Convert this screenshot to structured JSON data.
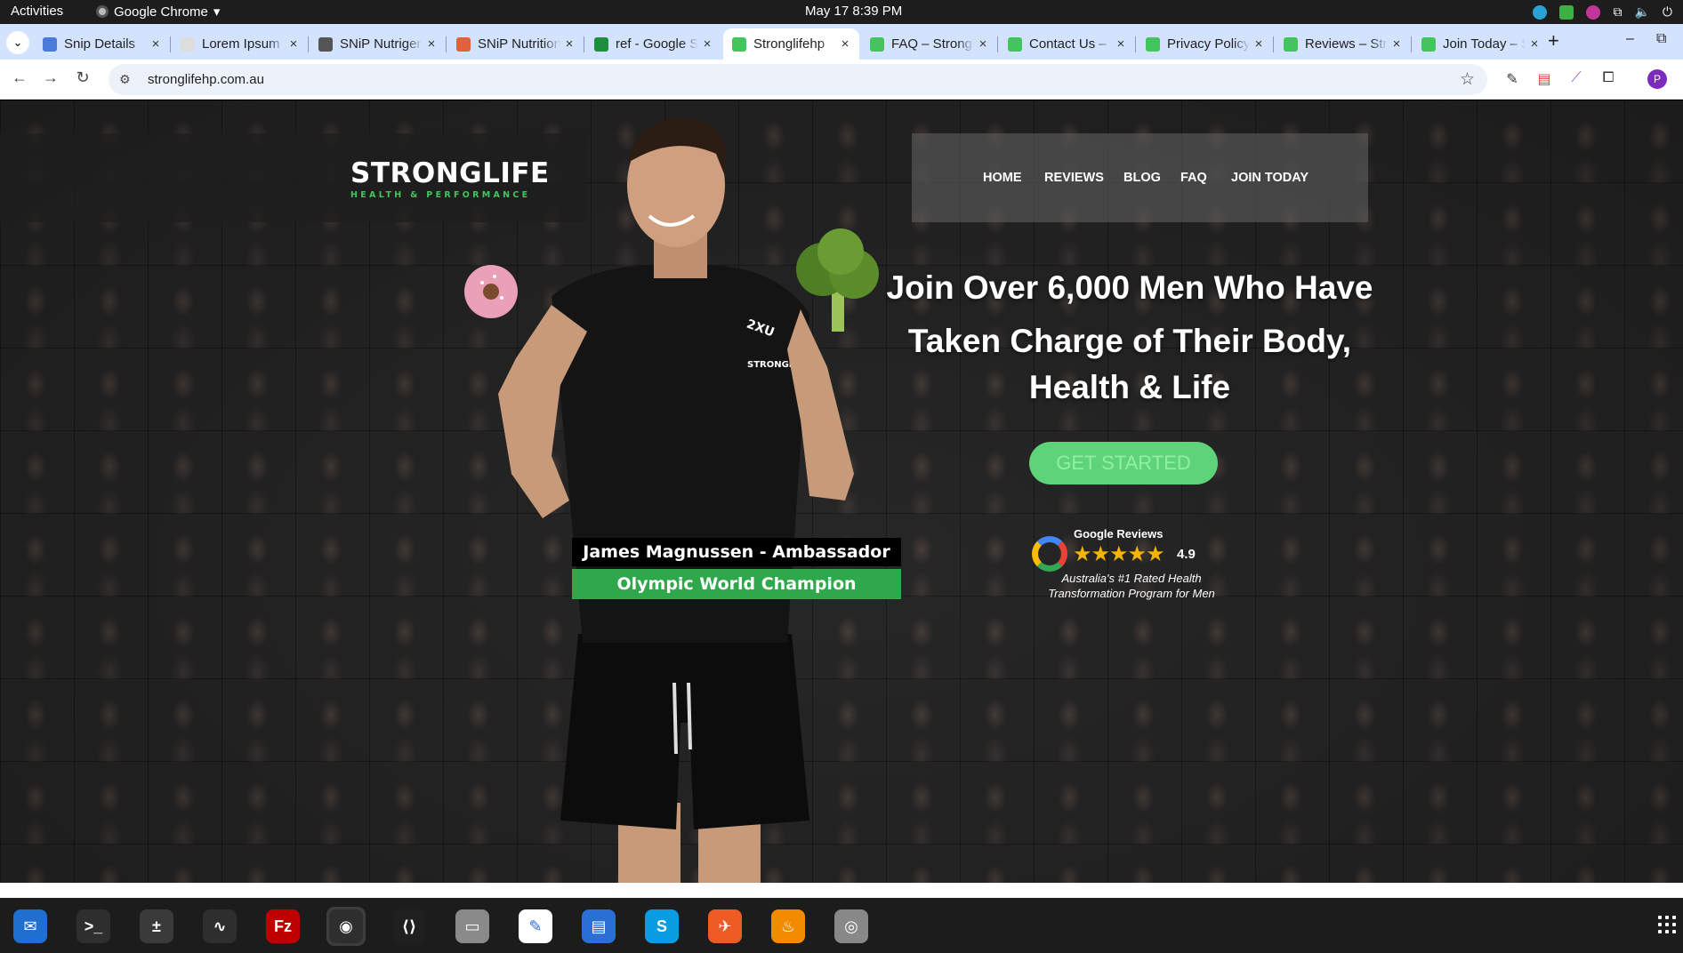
{
  "topbar": {
    "activities": "Activities",
    "app_name": "Google Chrome",
    "clock": "May 17  8:39 PM"
  },
  "tabs": [
    {
      "title": "Snip Details",
      "favicon_color": "#4a7bd8"
    },
    {
      "title": "Lorem Ipsum",
      "favicon_color": "#dddddd"
    },
    {
      "title": "SNiP Nutrigenomics",
      "favicon_color": "#555555"
    },
    {
      "title": "SNiP Nutrition",
      "favicon_color": "#e0623a"
    },
    {
      "title": "ref - Google Sheets",
      "favicon_color": "#1e8e3e"
    },
    {
      "title": "Stronglifehp",
      "favicon_color": "#43c55e",
      "active": true
    },
    {
      "title": "FAQ – Stronglife",
      "favicon_color": "#43c55e"
    },
    {
      "title": "Contact Us – Stronglife",
      "favicon_color": "#43c55e"
    },
    {
      "title": "Privacy Policy",
      "favicon_color": "#43c55e"
    },
    {
      "title": "Reviews – Stronglife",
      "favicon_color": "#43c55e"
    },
    {
      "title": "Join Today – Stronglife",
      "favicon_color": "#43c55e"
    }
  ],
  "address_bar": {
    "url": "stronglifehp.com.au"
  },
  "profile_initial": "P",
  "site": {
    "logo_main": "STRONGLIFE",
    "logo_sub": "HEALTH & PERFORMANCE",
    "nav": [
      "HOME",
      "REVIEWS",
      "BLOG",
      "FAQ",
      "JOIN TODAY"
    ],
    "hero_title_line1": "Join Over 6,000 Men Who Have",
    "hero_title_line2": "Taken Charge of Their Body,",
    "hero_title_line3": "Health & Life",
    "cta": "GET STARTED",
    "reviews_title": "Google Reviews",
    "reviews_stars": "★★★★★",
    "reviews_score": "4.9",
    "reviews_tagline_1": "Australia's #1 Rated Health",
    "reviews_tagline_2": "Transformation Program for Men",
    "ambassador": "James Magnussen - Ambassador",
    "champion": "Olympic World Champion",
    "shirt_logo": "STRONGLIFE",
    "shirt_brand": "2XU"
  },
  "dock": [
    {
      "name": "thunderbird",
      "color": "#1f6fd0"
    },
    {
      "name": "terminal",
      "color": "#2e2e2e"
    },
    {
      "name": "calculator",
      "color": "#3a3a3a"
    },
    {
      "name": "system-monitor",
      "color": "#2e2e2e"
    },
    {
      "name": "filezilla",
      "color": "#bf0000"
    },
    {
      "name": "chrome",
      "color": "#2e2e2e",
      "running": true
    },
    {
      "name": "vscode",
      "color": "#1f1f1f"
    },
    {
      "name": "files",
      "color": "#8a8a8a"
    },
    {
      "name": "text-editor",
      "color": "#ffffff"
    },
    {
      "name": "libreoffice-writer",
      "color": "#2a6fd6"
    },
    {
      "name": "skype",
      "color": "#0a9ce0"
    },
    {
      "name": "postman",
      "color": "#ef5b25"
    },
    {
      "name": "app-flame",
      "color": "#f28b00"
    },
    {
      "name": "disk-utility",
      "color": "#888888"
    }
  ]
}
